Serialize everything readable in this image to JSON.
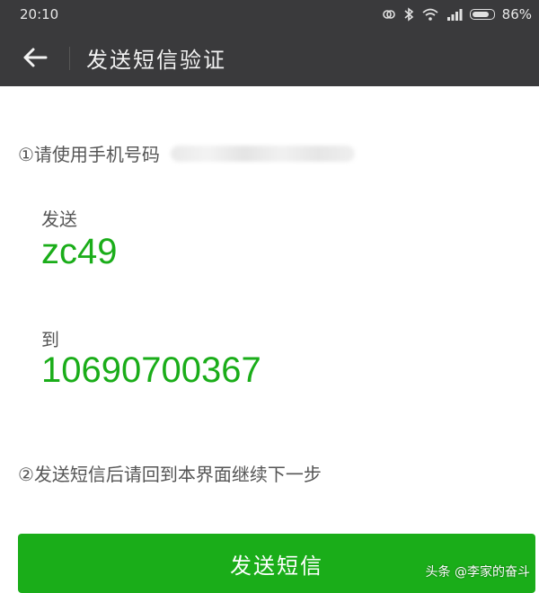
{
  "status_bar": {
    "time": "20:10",
    "battery_percent": "86%",
    "battery_level": 0.86,
    "icons": [
      "nfc-icon",
      "bluetooth-icon",
      "wifi-icon",
      "signal-icon",
      "battery-icon"
    ]
  },
  "header": {
    "title": "发送短信验证",
    "back_icon": "back-arrow-icon"
  },
  "instructions": {
    "step1": "①请使用手机号码",
    "step2": "②发送短信后请回到本界面继续下一步"
  },
  "sms": {
    "send_label": "发送",
    "code": "zc49",
    "to_label": "到",
    "number": "10690700367"
  },
  "action": {
    "button_label": "发送短信"
  },
  "watermark": "头条 @李家的奋斗",
  "colors": {
    "accent_green": "#1aad19",
    "header_bg": "#3a3a3c"
  }
}
